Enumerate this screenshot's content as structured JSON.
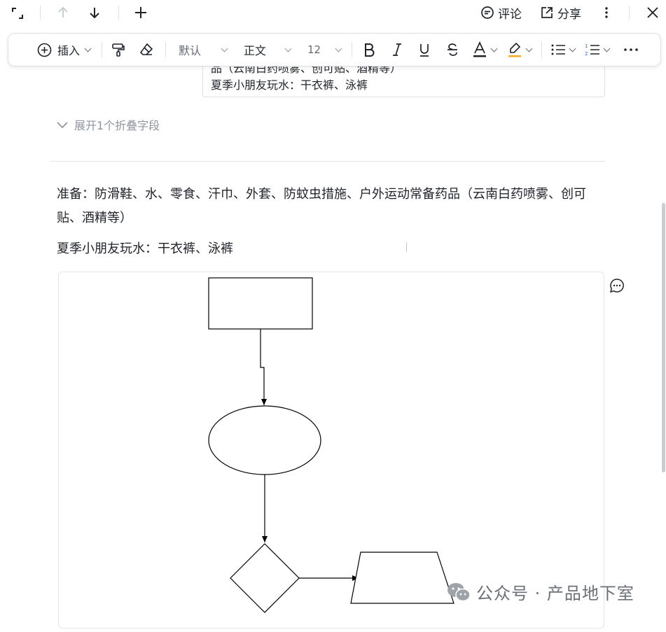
{
  "topbar": {
    "comment_label": "评论",
    "share_label": "分享"
  },
  "toolbar": {
    "insert_label": "插入",
    "font_family": "默认",
    "paragraph_style": "正文",
    "font_size": "12"
  },
  "table_cell": {
    "line1": "品（云南白药喷雾、创可贴、酒精等）",
    "line2": "夏季小朋友玩水：干衣裤、泳裤"
  },
  "expand_link": "展开1个折叠字段",
  "content": {
    "para1": "准备：防滑鞋、水、零食、汗巾、外套、防蚊虫措施、户外运动常备药品（云南白药喷雾、创可贴、酒精等）",
    "para2": "夏季小朋友玩水：干衣裤、泳裤"
  },
  "watermark": "公众号 · 产品地下室",
  "icons": [
    "fullscreen-icon",
    "arrow-up-icon",
    "arrow-down-icon",
    "plus-icon",
    "comment-icon",
    "share-icon",
    "more-vertical-icon",
    "close-icon",
    "insert-plus-icon",
    "format-painter-icon",
    "eraser-icon",
    "bold-icon",
    "italic-icon",
    "underline-icon",
    "strikethrough-icon",
    "text-color-icon",
    "highlight-icon",
    "bullet-list-icon",
    "numbered-list-icon",
    "more-horizontal-icon",
    "chevron-down-icon",
    "comment-bubble-icon",
    "wechat-icon"
  ],
  "colors": {
    "text": "#1f2329",
    "muted": "#8f959e",
    "border": "#dee0e3",
    "highlight_bar": "#f5a623"
  }
}
